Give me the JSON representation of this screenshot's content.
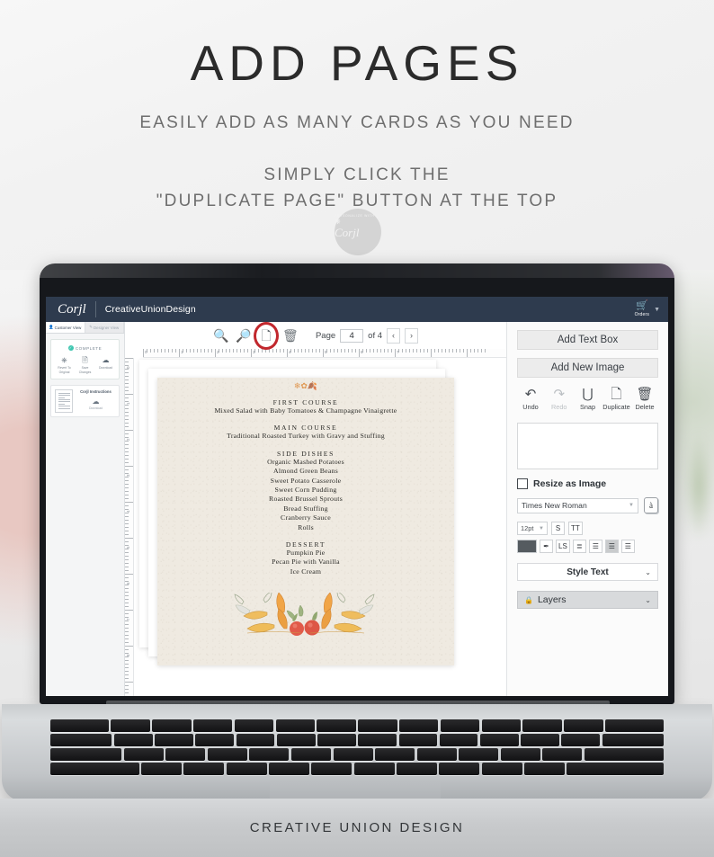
{
  "promo": {
    "title": "ADD PAGES",
    "subtitle": "EASILY ADD AS MANY CARDS AS YOU NEED",
    "instruction_line1": "SIMPLY CLICK THE",
    "instruction_line2": "\"DUPLICATE PAGE\" BUTTON AT THE TOP",
    "badge": {
      "top_text": "PERSONALIZE WITH",
      "brand": "Corjl",
      "flower_icon": "flower-icon"
    }
  },
  "app": {
    "header": {
      "logo": "Corjl",
      "shop_name": "CreativeUnionDesign",
      "cart_icon": "shopping-cart-icon",
      "cart_label": "Orders",
      "caret_icon": "chevron-down-icon"
    },
    "sidebar": {
      "tabs": [
        {
          "label": "Customer View",
          "icon": "person-icon",
          "active": true
        },
        {
          "label": "Designer View",
          "icon": "pencil-icon",
          "active": false
        }
      ],
      "status_card": {
        "status": "COMPLETE",
        "check_icon": "check-circle-icon",
        "actions": [
          {
            "icon": "revert-icon",
            "label_line1": "Revert To",
            "label_line2": "Original"
          },
          {
            "icon": "save-icon",
            "label_line1": "Save",
            "label_line2": "Changes"
          },
          {
            "icon": "download-cloud-icon",
            "label_line1": "Download",
            "label_line2": ""
          }
        ]
      },
      "items": [
        {
          "title": "Corjl Instructions",
          "icon": "download-cloud-icon",
          "action": "Download",
          "thumb": "document-thumb-icon"
        }
      ]
    },
    "toolbar": {
      "zoom_in_icon": "zoom-in-icon",
      "zoom_out_icon": "zoom-out-icon",
      "duplicate_page_icon": "duplicate-page-icon",
      "delete_page_icon": "trash-icon",
      "page_label": "Page",
      "page_value": "4",
      "of_label": "of 4",
      "prev_icon": "chevron-left-icon",
      "next_icon": "chevron-right-icon",
      "highlight_color": "#c1272d"
    },
    "rulers": {
      "vertical_numbers": [
        "0",
        "1",
        "2",
        "3",
        "4",
        "5",
        "6",
        "7",
        "8"
      ],
      "horizontal_numbers": [
        "0",
        "1",
        "2",
        "3",
        "4",
        "5",
        "6",
        "7"
      ]
    },
    "right_panel": {
      "add_text_box": "Add Text Box",
      "add_new_image": "Add New Image",
      "tools": [
        {
          "label": "Undo",
          "icon": "undo-icon",
          "disabled": false
        },
        {
          "label": "Redo",
          "icon": "redo-icon",
          "disabled": true
        },
        {
          "label": "Snap",
          "icon": "magnet-icon",
          "disabled": false
        },
        {
          "label": "Duplicate",
          "icon": "copy-icon",
          "disabled": false
        },
        {
          "label": "Delete",
          "icon": "trash-icon",
          "disabled": false
        }
      ],
      "text_value": "",
      "text_placeholder": "",
      "resize_as_image": {
        "label": "Resize as Image",
        "checked": false
      },
      "font_family": "Times New Roman",
      "special_char_icon": "special-character-icon",
      "special_char_glyph": "à",
      "font_size": "12pt",
      "strikethrough": "S",
      "caps": "TT",
      "text_color": "#555b60",
      "eyedropper_icon": "eyedropper-icon",
      "letter_spacing": "LS",
      "line_spacing_icon": "line-spacing-icon",
      "align_left_icon": "align-left-icon",
      "align_center_icon": "align-center-icon",
      "align_right_icon": "align-right-icon",
      "align_active": "center",
      "style_text": "Style Text",
      "layers": "Layers",
      "lock_icon": "lock-icon",
      "caret_icon": "chevron-down-icon"
    }
  },
  "menu_card": {
    "top_decoration": "autumn-sprig-decoration",
    "sections": [
      {
        "heading": "FIRST COURSE",
        "items": [
          "Mixed Salad with Baby Tomatoes & Champagne Vinaigrette"
        ]
      },
      {
        "heading": "MAIN COURSE",
        "items": [
          "Traditional Roasted Turkey with Gravy and Stuffing"
        ]
      },
      {
        "heading": "SIDE DISHES",
        "items": [
          "Organic Mashed Potatoes",
          "Almond Green Beans",
          "Sweet Potato Casserole",
          "Sweet Corn Pudding",
          "Roasted Brussel Sprouts",
          "Bread Stuffing",
          "Cranberry Sauce",
          "Rolls"
        ]
      },
      {
        "heading": "DESSERT",
        "items": [
          "Pumpkin Pie",
          "Pecan Pie with Vanilla",
          "Ice Cream"
        ]
      }
    ],
    "bottom_decoration": "autumn-leaves-berries-decoration"
  },
  "footer": {
    "text": "CREATIVE UNION DESIGN"
  }
}
